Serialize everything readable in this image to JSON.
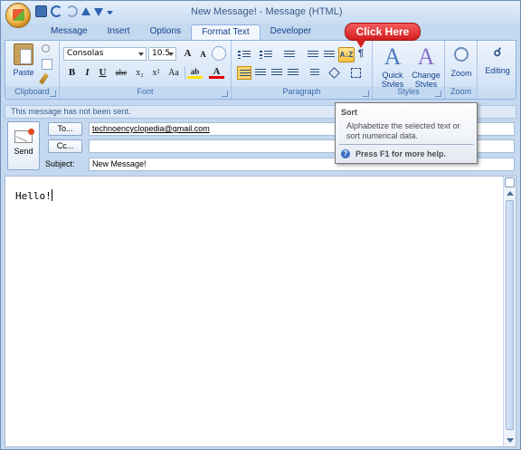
{
  "window": {
    "title": "New Message! - Message (HTML)"
  },
  "tabs": [
    {
      "label": "Message"
    },
    {
      "label": "Insert"
    },
    {
      "label": "Options"
    },
    {
      "label": "Format Text",
      "active": true
    },
    {
      "label": "Developer"
    }
  ],
  "ribbon": {
    "clipboard": {
      "label": "Clipboard",
      "paste_label": "Paste"
    },
    "font": {
      "label": "Font",
      "font_name": "Consolas",
      "font_size": "10.5",
      "bold": "B",
      "italic": "I",
      "underline": "U",
      "strike": "abc",
      "subscript": "x₂",
      "superscript": "x²",
      "change_case": "Aa",
      "grow": "A",
      "shrink": "A",
      "highlight": "ab",
      "font_color": "A"
    },
    "paragraph": {
      "label": "Paragraph",
      "sort_glyph": "A↓Z"
    },
    "styles": {
      "label": "Styles",
      "quick_styles": "Quick Styles",
      "change_styles": "Change Styles",
      "glyph": "A"
    },
    "zoom": {
      "label": "Zoom",
      "zoom_button": "Zoom"
    },
    "editing": {
      "label": "Editing"
    }
  },
  "callout": {
    "text": "Click Here"
  },
  "infobar": {
    "text": "This message has not been sent."
  },
  "compose": {
    "send_label": "Send",
    "to_button": "To...",
    "cc_button": "Cc...",
    "subject_label": "Subject:",
    "to_value": "technoencyclopedia@gmail.com",
    "cc_value": "",
    "subject_value": "New Message!",
    "body_text": "Hello!"
  },
  "tooltip": {
    "title": "Sort",
    "body": "Alphabetize the selected text or sort numerical data.",
    "help": "Press F1 for more help."
  },
  "colors": {
    "accent": "#15428b",
    "ribbon_bg": "#d6e5f7",
    "callout": "#d41d1d",
    "sort_highlight": "#ffc23f"
  }
}
